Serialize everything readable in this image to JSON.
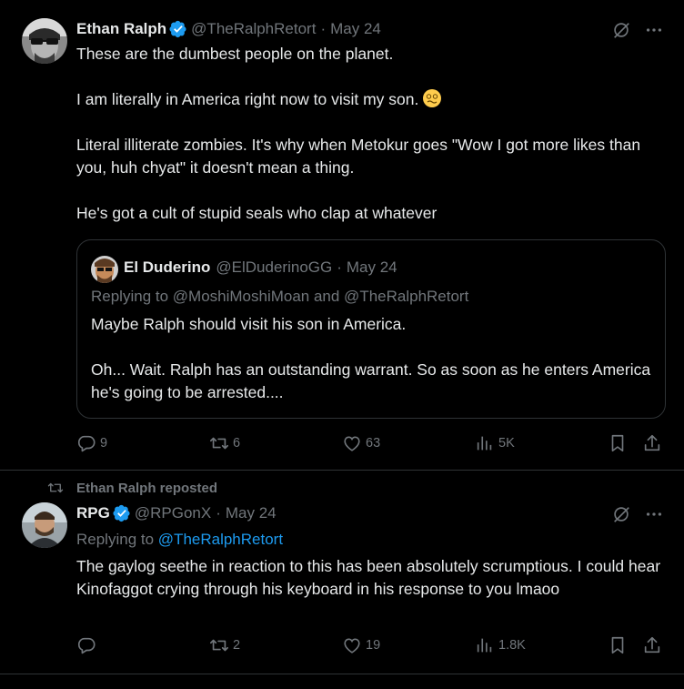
{
  "tweets": [
    {
      "author_name": "Ethan Ralph",
      "handle": "@TheRalphRetort",
      "date": "May 24",
      "lines": [
        "These are the dumbest people on the planet.",
        "I am literally in America right now to visit my son.",
        "Literal illiterate zombies. It's why when Metokur goes \"Wow I got more likes than you, huh chyat\" it doesn't mean a thing.",
        "He's got a cult of stupid seals who clap at whatever"
      ],
      "quote": {
        "author_name": "El Duderino",
        "handle": "@ElDuderinoGG",
        "date": "May 24",
        "replying_to": "Replying to @MoshiMoshiMoan and @TheRalphRetort",
        "lines": [
          "Maybe Ralph should visit his son in America.",
          "Oh... Wait. Ralph has an outstanding warrant. So as soon as he enters America he's going to be arrested...."
        ]
      },
      "stats": {
        "replies": "9",
        "reposts": "6",
        "likes": "63",
        "views": "5K"
      }
    },
    {
      "repost_banner": "Ethan Ralph reposted",
      "author_name": "RPG",
      "handle": "@RPGonX",
      "date": "May 24",
      "replying_prefix": "Replying to",
      "replying_mention": "@TheRalphRetort",
      "lines": [
        "The gaylog seethe in reaction to this has been absolutely scrumptious. I could hear Kinofaggot crying through his keyboard in his response to you lmaoo"
      ],
      "stats": {
        "replies": "",
        "reposts": "2",
        "likes": "19",
        "views": "1.8K"
      }
    }
  ],
  "separator": "·",
  "icons": [
    "verified-badge-icon",
    "grok-icon",
    "more-icon",
    "reply-icon",
    "repost-icon",
    "like-icon",
    "views-icon",
    "bookmark-icon",
    "share-icon",
    "woozy-face-emoji"
  ],
  "colors": {
    "background": "#000000",
    "text": "#e7e9ea",
    "muted": "#71767b",
    "accent": "#1d9bf0",
    "border": "#2f3336"
  }
}
